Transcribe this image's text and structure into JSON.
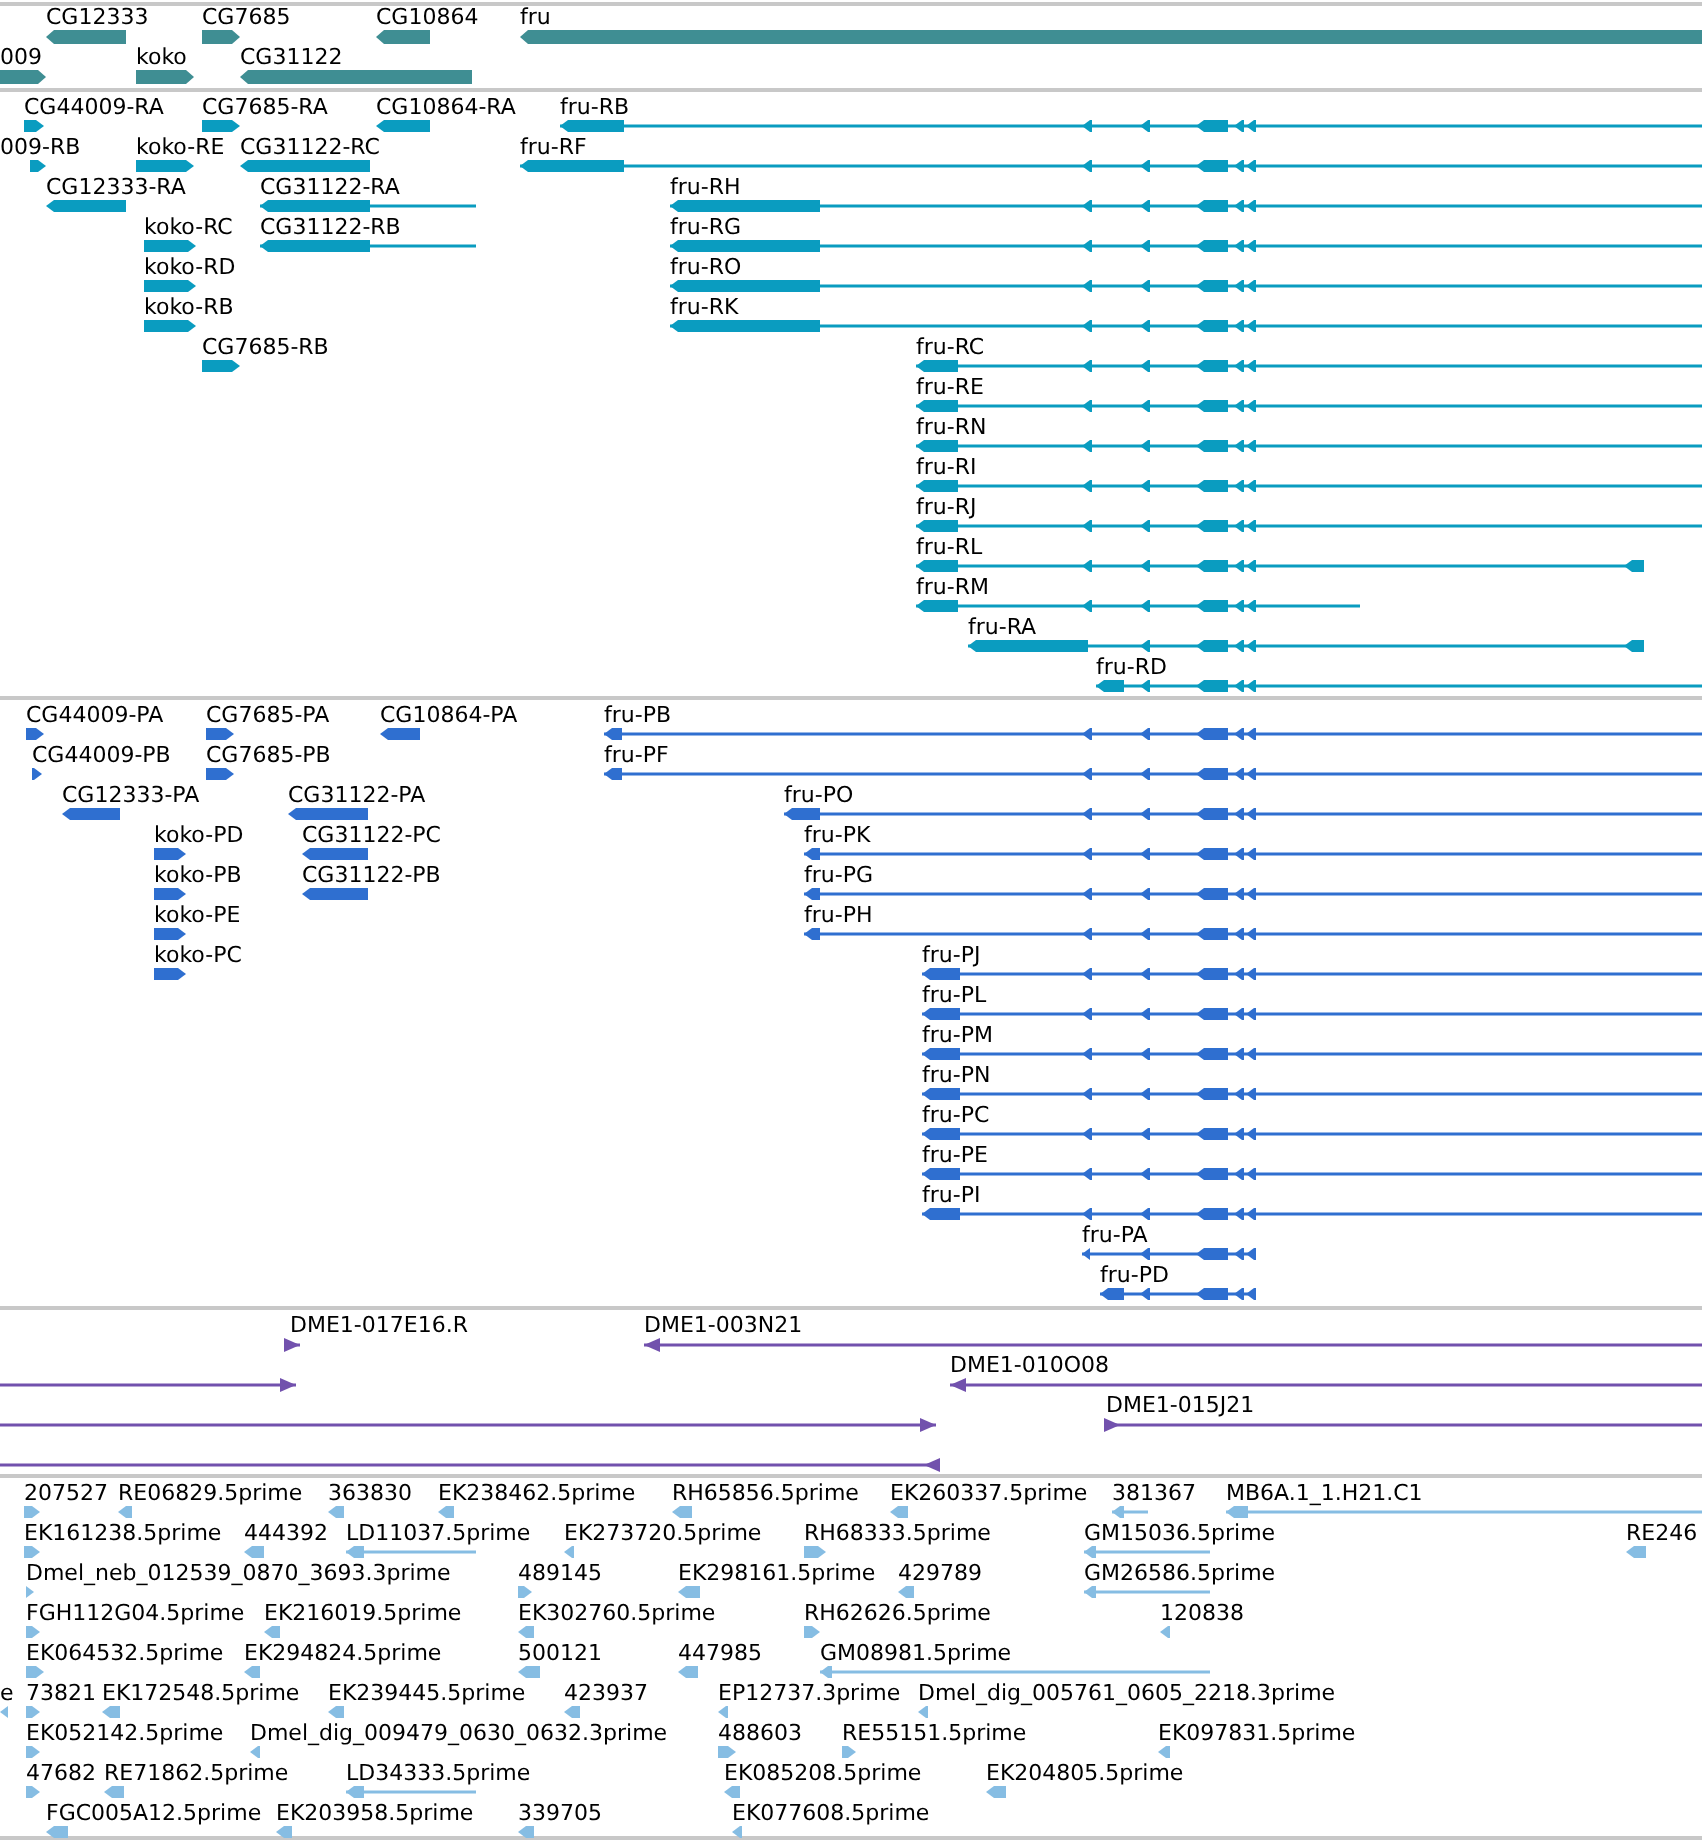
{
  "tracks": [
    {
      "kind": "genes",
      "features": [
        {
          "label": "CG12333",
          "reverse": true
        },
        {
          "label": "CG7685",
          "reverse": false
        },
        {
          "label": "CG10864",
          "reverse": true
        },
        {
          "label": "fru",
          "reverse": true
        },
        {
          "label": "009",
          "reverse": false
        },
        {
          "label": "koko",
          "reverse": false
        },
        {
          "label": "CG31122",
          "reverse": true
        }
      ]
    },
    {
      "kind": "transcripts",
      "features": [
        {
          "label": "CG44009-RA",
          "reverse": false
        },
        {
          "label": "CG7685-RA",
          "reverse": false
        },
        {
          "label": "CG10864-RA",
          "reverse": true
        },
        {
          "label": "fru-RB",
          "reverse": true
        },
        {
          "label": "009-RB",
          "reverse": false
        },
        {
          "label": "koko-RE",
          "reverse": false
        },
        {
          "label": "CG31122-RC",
          "reverse": true
        },
        {
          "label": "fru-RF",
          "reverse": true
        },
        {
          "label": "CG12333-RA",
          "reverse": true
        },
        {
          "label": "CG31122-RA",
          "reverse": true
        },
        {
          "label": "fru-RH",
          "reverse": true
        },
        {
          "label": "koko-RC",
          "reverse": false
        },
        {
          "label": "CG31122-RB",
          "reverse": true
        },
        {
          "label": "fru-RG",
          "reverse": true
        },
        {
          "label": "koko-RD",
          "reverse": false
        },
        {
          "label": "fru-RO",
          "reverse": true
        },
        {
          "label": "koko-RB",
          "reverse": false
        },
        {
          "label": "fru-RK",
          "reverse": true
        },
        {
          "label": "CG7685-RB",
          "reverse": false
        },
        {
          "label": "fru-RC",
          "reverse": true
        },
        {
          "label": "fru-RE",
          "reverse": true
        },
        {
          "label": "fru-RN",
          "reverse": true
        },
        {
          "label": "fru-RI",
          "reverse": true
        },
        {
          "label": "fru-RJ",
          "reverse": true
        },
        {
          "label": "fru-RL",
          "reverse": true
        },
        {
          "label": "fru-RM",
          "reverse": true
        },
        {
          "label": "fru-RA",
          "reverse": true
        },
        {
          "label": "fru-RD",
          "reverse": true
        }
      ]
    },
    {
      "kind": "proteins",
      "features": [
        {
          "label": "CG44009-PA",
          "reverse": false
        },
        {
          "label": "CG7685-PA",
          "reverse": false
        },
        {
          "label": "CG10864-PA",
          "reverse": true
        },
        {
          "label": "fru-PB",
          "reverse": true
        },
        {
          "label": "CG44009-PB",
          "reverse": false
        },
        {
          "label": "CG7685-PB",
          "reverse": false
        },
        {
          "label": "fru-PF",
          "reverse": true
        },
        {
          "label": "CG12333-PA",
          "reverse": true
        },
        {
          "label": "CG31122-PA",
          "reverse": true
        },
        {
          "label": "fru-PO",
          "reverse": true
        },
        {
          "label": "koko-PD",
          "reverse": false
        },
        {
          "label": "CG31122-PC",
          "reverse": true
        },
        {
          "label": "fru-PK",
          "reverse": true
        },
        {
          "label": "koko-PB",
          "reverse": false
        },
        {
          "label": "CG31122-PB",
          "reverse": true
        },
        {
          "label": "fru-PG",
          "reverse": true
        },
        {
          "label": "koko-PE",
          "reverse": false
        },
        {
          "label": "fru-PH",
          "reverse": true
        },
        {
          "label": "koko-PC",
          "reverse": false
        },
        {
          "label": "fru-PJ",
          "reverse": true
        },
        {
          "label": "fru-PL",
          "reverse": true
        },
        {
          "label": "fru-PM",
          "reverse": true
        },
        {
          "label": "fru-PN",
          "reverse": true
        },
        {
          "label": "fru-PC",
          "reverse": true
        },
        {
          "label": "fru-PE",
          "reverse": true
        },
        {
          "label": "fru-PI",
          "reverse": true
        },
        {
          "label": "fru-PA",
          "reverse": true
        },
        {
          "label": "fru-PD",
          "reverse": true
        }
      ]
    },
    {
      "kind": "clones",
      "features": [
        {
          "label": "DME1-017E16.R",
          "reverse": false
        },
        {
          "label": "DME1-003N21",
          "reverse": true
        },
        {
          "reverse": false
        },
        {
          "label": "DME1-010O08",
          "reverse": true
        },
        {
          "reverse": false
        },
        {
          "label": "DME1-015J21",
          "reverse": false
        },
        {
          "reverse": true
        }
      ]
    },
    {
      "kind": "ests",
      "features": [
        {
          "label": "207527",
          "reverse": false
        },
        {
          "label": "RE06829.5prime",
          "reverse": true
        },
        {
          "label": "363830",
          "reverse": true
        },
        {
          "label": "EK238462.5prime",
          "reverse": true
        },
        {
          "label": "RH65856.5prime",
          "reverse": true
        },
        {
          "label": "EK260337.5prime",
          "reverse": true
        },
        {
          "label": "381367",
          "reverse": true
        },
        {
          "label": "MB6A.1_1.H21.C1",
          "reverse": true
        },
        {
          "label": "EK161238.5prime",
          "reverse": false
        },
        {
          "label": "444392",
          "reverse": true
        },
        {
          "label": "LD11037.5prime",
          "reverse": true
        },
        {
          "label": "EK273720.5prime",
          "reverse": true
        },
        {
          "label": "RH68333.5prime",
          "reverse": false
        },
        {
          "label": "GM15036.5prime",
          "reverse": true
        },
        {
          "label": "RE246",
          "reverse": true
        },
        {
          "label": "Dmel_neb_012539_0870_3693.3prime",
          "reverse": false
        },
        {
          "label": "489145",
          "reverse": false
        },
        {
          "label": "EK298161.5prime",
          "reverse": true
        },
        {
          "label": "429789",
          "reverse": true
        },
        {
          "label": "GM26586.5prime",
          "reverse": true
        },
        {
          "label": "FGH112G04.5prime",
          "reverse": false
        },
        {
          "label": "EK216019.5prime",
          "reverse": true
        },
        {
          "label": "EK302760.5prime",
          "reverse": true
        },
        {
          "label": "RH62626.5prime",
          "reverse": false
        },
        {
          "label": "120838",
          "reverse": true
        },
        {
          "label": "EK064532.5prime",
          "reverse": false
        },
        {
          "label": "EK294824.5prime",
          "reverse": true
        },
        {
          "label": "500121",
          "reverse": true
        },
        {
          "label": "447985",
          "reverse": true
        },
        {
          "label": "GM08981.5prime",
          "reverse": true
        },
        {
          "label": "e",
          "reverse": true
        },
        {
          "label": "73821",
          "reverse": false
        },
        {
          "label": "EK172548.5prime",
          "reverse": true
        },
        {
          "label": "EK239445.5prime",
          "reverse": true
        },
        {
          "label": "423937",
          "reverse": true
        },
        {
          "label": "EP12737.3prime",
          "reverse": true
        },
        {
          "label": "Dmel_dig_005761_0605_2218.3prime",
          "reverse": true
        },
        {
          "label": "EK052142.5prime",
          "reverse": false
        },
        {
          "label": "Dmel_dig_009479_0630_0632.3prime",
          "reverse": true
        },
        {
          "label": "488603",
          "reverse": false
        },
        {
          "label": "RE55151.5prime",
          "reverse": false
        },
        {
          "label": "EK097831.5prime",
          "reverse": true
        },
        {
          "label": "47682",
          "reverse": false
        },
        {
          "label": "RE71862.5prime",
          "reverse": true
        },
        {
          "label": "LD34333.5prime",
          "reverse": true
        },
        {
          "label": "EK085208.5prime",
          "reverse": true
        },
        {
          "label": "EK204805.5prime",
          "reverse": true
        },
        {
          "label": "FGC005A12.5prime",
          "reverse": true
        },
        {
          "label": "EK203958.5prime",
          "reverse": true
        },
        {
          "label": "339705",
          "reverse": true
        },
        {
          "label": "EK077608.5prime",
          "reverse": true
        }
      ]
    }
  ]
}
